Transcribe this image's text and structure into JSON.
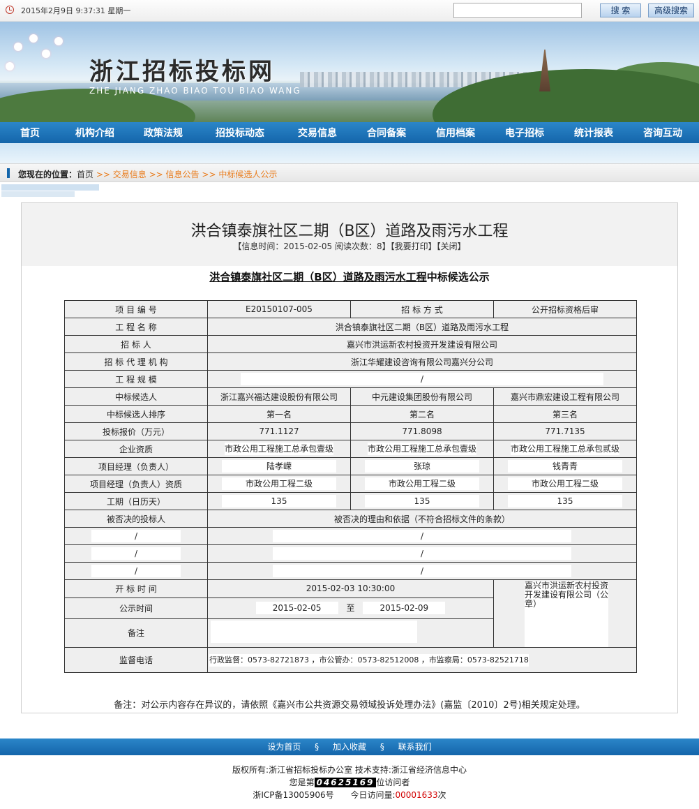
{
  "topbar": {
    "datetime": "2015年2月9日  9:37:31  星期一",
    "search_placeholder": "",
    "search_button": "搜 索",
    "advanced_button": "高级搜索"
  },
  "banner": {
    "title": "浙江招标投标网",
    "subtitle": "ZHE  JIANG  ZHAO  BIAO  TOU  BIAO  WANG"
  },
  "nav": {
    "items": [
      "首页",
      "机构介绍",
      "政策法规",
      "招投标动态",
      "交易信息",
      "合同备案",
      "信用档案",
      "电子招标",
      "统计报表",
      "咨询互动"
    ]
  },
  "breadcrumb": {
    "label": "您现在的位置：",
    "home": "首页",
    "c1": ">> 交易信息",
    "c2": ">> 信息公告",
    "c3": ">> 中标候选人公示"
  },
  "article": {
    "title": "洪合镇泰旗社区二期（B区）道路及雨污水工程",
    "meta": "【信息时间：2015-02-05  阅读次数：8】【我要打印】【关闭】",
    "notice_title_underlined": "洪合镇泰旗社区二期（B区）道路及雨污水工程",
    "notice_title_rest": "中标候选公示",
    "footnote": "备注：对公示内容存在异议的，请依照《嘉兴市公共资源交易领域投诉处理办法》(嘉监〔2010〕2号)相关规定处理。"
  },
  "table": {
    "project_no_label": "项 目 编 号",
    "project_no": "E20150107-005",
    "method_label": "招 标 方 式",
    "method": "公开招标资格后审",
    "name_label": "工 程 名 称",
    "name": "洪合镇泰旗社区二期（B区）道路及雨污水工程",
    "tenderer_label": "招 标 人",
    "tenderer": "嘉兴市洪运新农村投资开发建设有限公司",
    "agency_label": "招 标 代 理 机 构",
    "agency": "浙江华耀建设咨询有限公司嘉兴分公司",
    "scale_label": "工 程 规 模",
    "scale": "/",
    "candidate_label": "中标候选人",
    "candidates": [
      "浙江嘉兴福达建设股份有限公司",
      "中元建设集团股份有限公司",
      "嘉兴市鼎宏建设工程有限公司"
    ],
    "rank_label": "中标候选人排序",
    "ranks": [
      "第一名",
      "第二名",
      "第三名"
    ],
    "price_label": "投标报价（万元）",
    "prices": [
      "771.1127",
      "771.8098",
      "771.7135"
    ],
    "qual_label": "企业资质",
    "quals": [
      "市政公用工程施工总承包壹级",
      "市政公用工程施工总承包壹级",
      "市政公用工程施工总承包贰级"
    ],
    "manager_label": "项目经理（负责人）",
    "managers": [
      "陆孝嵘",
      "张琼",
      "钱青青"
    ],
    "manager_qual_label": "项目经理（负责人）资质",
    "manager_quals": [
      "市政公用工程二级",
      "市政公用工程二级",
      "市政公用工程二级"
    ],
    "period_label": "工期（日历天）",
    "periods": [
      "135",
      "135",
      "135"
    ],
    "rejected_label": "被否决的投标人",
    "rejected_reason_label": "被否决的理由和依据（不符合招标文件的条款）",
    "rejected_rows": [
      {
        "bidder": "/",
        "reason": "/"
      },
      {
        "bidder": "/",
        "reason": "/"
      },
      {
        "bidder": "/",
        "reason": "/"
      }
    ],
    "open_time_label": "开 标 时 间",
    "open_time": "2015-02-03 10:30:00",
    "stamp_org": "嘉兴市洪运新农村投资开发建设有限公司（公章）",
    "publicity_label": "公示时间",
    "publicity_from": "2015-02-05",
    "publicity_to_label": "至",
    "publicity_to": "2015-02-09",
    "remark_label": "备注",
    "phone_label": "监督电话",
    "phones": "行政监督：0573-82721873  ，市公管办：0573-82512008  ，市监察局：0573-82521718"
  },
  "footer": {
    "links": [
      "设为首页",
      "§",
      "加入收藏",
      "§",
      "联系我们"
    ],
    "copyright": "版权所有:浙江省招标投标办公室  技术支持:浙江省经济信息中心",
    "visitor_prefix": "您是第",
    "visitor_count": "04625169",
    "visitor_suffix": "位访问者",
    "icp": "浙ICP备13005906号",
    "today_prefix": "今日访问量:",
    "today_count": "00001633",
    "today_suffix": "次"
  }
}
